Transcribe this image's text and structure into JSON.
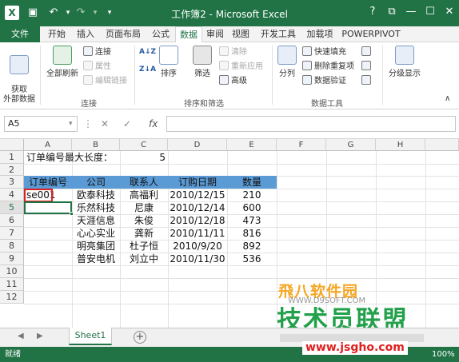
{
  "window": {
    "title": "工作簿2 - Microsoft Excel",
    "logo": "X"
  },
  "titlebar": {
    "help": "?",
    "restore": "⧉",
    "minimize": "—",
    "maximize": "☐",
    "close": "✕"
  },
  "tabs": [
    "文件",
    "开始",
    "插入",
    "页面布局",
    "公式",
    "数据",
    "审阅",
    "视图",
    "开发工具",
    "加载项",
    "POWERPIVOT"
  ],
  "ribbon": {
    "get_external": "获取\n外部数据",
    "refresh_all": "全部刷新",
    "connections": "连接",
    "properties": "属性",
    "edit_links": "编辑链接",
    "group_connections": "连接",
    "sort_az": "A↓Z",
    "sort": "排序",
    "filter": "筛选",
    "clear": "清除",
    "reapply": "重新应用",
    "advanced": "高级",
    "group_sort_filter": "排序和筛选",
    "split": "分列",
    "flash_fill": "快速填充",
    "remove_dup": "删除重复项",
    "validation": "数据验证",
    "group_data_tools": "数据工具",
    "outline": "分级显示"
  },
  "formula_bar": {
    "name_box": "A5",
    "fx": "fx",
    "cancel": "✕",
    "enter": "✓",
    "value": ""
  },
  "columns": [
    "A",
    "B",
    "C",
    "D",
    "E",
    "F",
    "G",
    "H"
  ],
  "rows": [
    "1",
    "2",
    "3",
    "4",
    "5",
    "6",
    "7",
    "8",
    "9",
    "10",
    "11",
    "12"
  ],
  "cells": {
    "a1": "订单编号最大长度：",
    "c1": "5",
    "headers": [
      "订单编号",
      "公司",
      "联系人",
      "订购日期",
      "数量"
    ],
    "data": [
      [
        "se001",
        "欧泰科技",
        "高福利",
        "2010/12/15",
        "210"
      ],
      [
        "",
        "乐然科技",
        "尼康",
        "2010/12/14",
        "600"
      ],
      [
        "",
        "天涯信息",
        "朱俊",
        "2010/12/18",
        "473"
      ],
      [
        "",
        "心心实业",
        "龚新",
        "2010/11/11",
        "816"
      ],
      [
        "",
        "明亮集团",
        "杜子恒",
        "2010/9/20",
        "892"
      ],
      [
        "",
        "普安电机",
        "刘立中",
        "2010/11/30",
        "536"
      ]
    ]
  },
  "sheet_tab": "Sheet1",
  "add_sheet": "+",
  "status": {
    "state": "就绪",
    "zoom": "100%"
  },
  "watermark": {
    "line1": "飛八软件园",
    "line1b": "WWW.D9SOFT.COM",
    "line2": "技术员联盟",
    "line3": "www.jsgho.com"
  },
  "colors": {
    "excel_green": "#217346",
    "header_fill": "#5b9bd5",
    "highlight": "#e02020"
  }
}
